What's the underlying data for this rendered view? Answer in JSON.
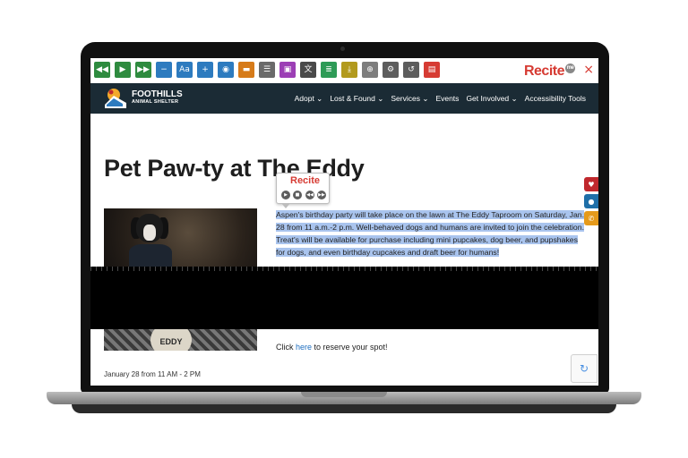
{
  "toolbar": {
    "buttons": [
      {
        "name": "rewind-icon",
        "glyph": "◀◀",
        "color": "#2e8b3f"
      },
      {
        "name": "play-icon",
        "glyph": "▶",
        "color": "#2e8b3f"
      },
      {
        "name": "fast-forward-icon",
        "glyph": "▶▶",
        "color": "#2e8b3f"
      },
      {
        "name": "decrease-text-icon",
        "glyph": "−",
        "color": "#2d7bbf"
      },
      {
        "name": "font-icon",
        "glyph": "Aa",
        "color": "#2d7bbf"
      },
      {
        "name": "increase-text-icon",
        "glyph": "+",
        "color": "#2d7bbf"
      },
      {
        "name": "color-wheel-icon",
        "glyph": "◉",
        "color": "#2d7bbf"
      },
      {
        "name": "highlight-bar-icon",
        "glyph": "▬",
        "color": "#d67b1a"
      },
      {
        "name": "ruler-icon",
        "glyph": "☰",
        "color": "#6a6a6a"
      },
      {
        "name": "dictionary-icon",
        "glyph": "▣",
        "color": "#9c3fb5"
      },
      {
        "name": "translate-icon",
        "glyph": "文",
        "color": "#4a4a4a"
      },
      {
        "name": "text-mode-icon",
        "glyph": "≣",
        "color": "#2e9b57"
      },
      {
        "name": "download-icon",
        "glyph": "⤓",
        "color": "#b29a1e"
      },
      {
        "name": "magnifier-icon",
        "glyph": "⊕",
        "color": "#7d7d7d"
      },
      {
        "name": "settings-icon",
        "glyph": "⚙",
        "color": "#5d5d5d"
      },
      {
        "name": "reset-icon",
        "glyph": "↺",
        "color": "#5d5d5d"
      },
      {
        "name": "pdf-icon",
        "glyph": "▤",
        "color": "#d63b33"
      }
    ],
    "logo": "Recite",
    "logo_badge": "me",
    "close": "×"
  },
  "site": {
    "brand": "FOOTHILLS",
    "brand_sub": "ANIMAL SHELTER",
    "nav": [
      "Adopt ⌄",
      "Lost & Found ⌄",
      "Services ⌄",
      "Events",
      "Get Involved ⌄",
      "Accessibility Tools"
    ]
  },
  "page": {
    "title": "Pet Paw-ty at The Eddy",
    "paragraph": "Aspen's birthday party will take place on the lawn at The Eddy Taproom on Saturday, Jan. 28 from 11 a.m.-2 p.m. Well-behaved dogs and humans are invited to join the celebration. Treat's will be available for purchase including mini pupcakes, dog beer, and pupshakes for dogs, and even birthday cupcakes and draft beer for humans!",
    "reserve_prefix": "Click ",
    "reserve_link": "here",
    "reserve_suffix": " to reserve your spot!",
    "date": "January 28 from 11 AM - 2 PM",
    "eddy_sign": "EDDY"
  },
  "popup": {
    "logo": "Recite",
    "controls": [
      "▶",
      "■",
      "◀◀",
      "▶▶"
    ]
  },
  "side_tabs": [
    {
      "name": "heart-icon",
      "glyph": "♥",
      "color": "#c0282d"
    },
    {
      "name": "location-pin-icon",
      "glyph": "●",
      "color": "#1f6fa8"
    },
    {
      "name": "phone-icon",
      "glyph": "✆",
      "color": "#e59a1b"
    }
  ],
  "recaptcha_glyph": "↻"
}
